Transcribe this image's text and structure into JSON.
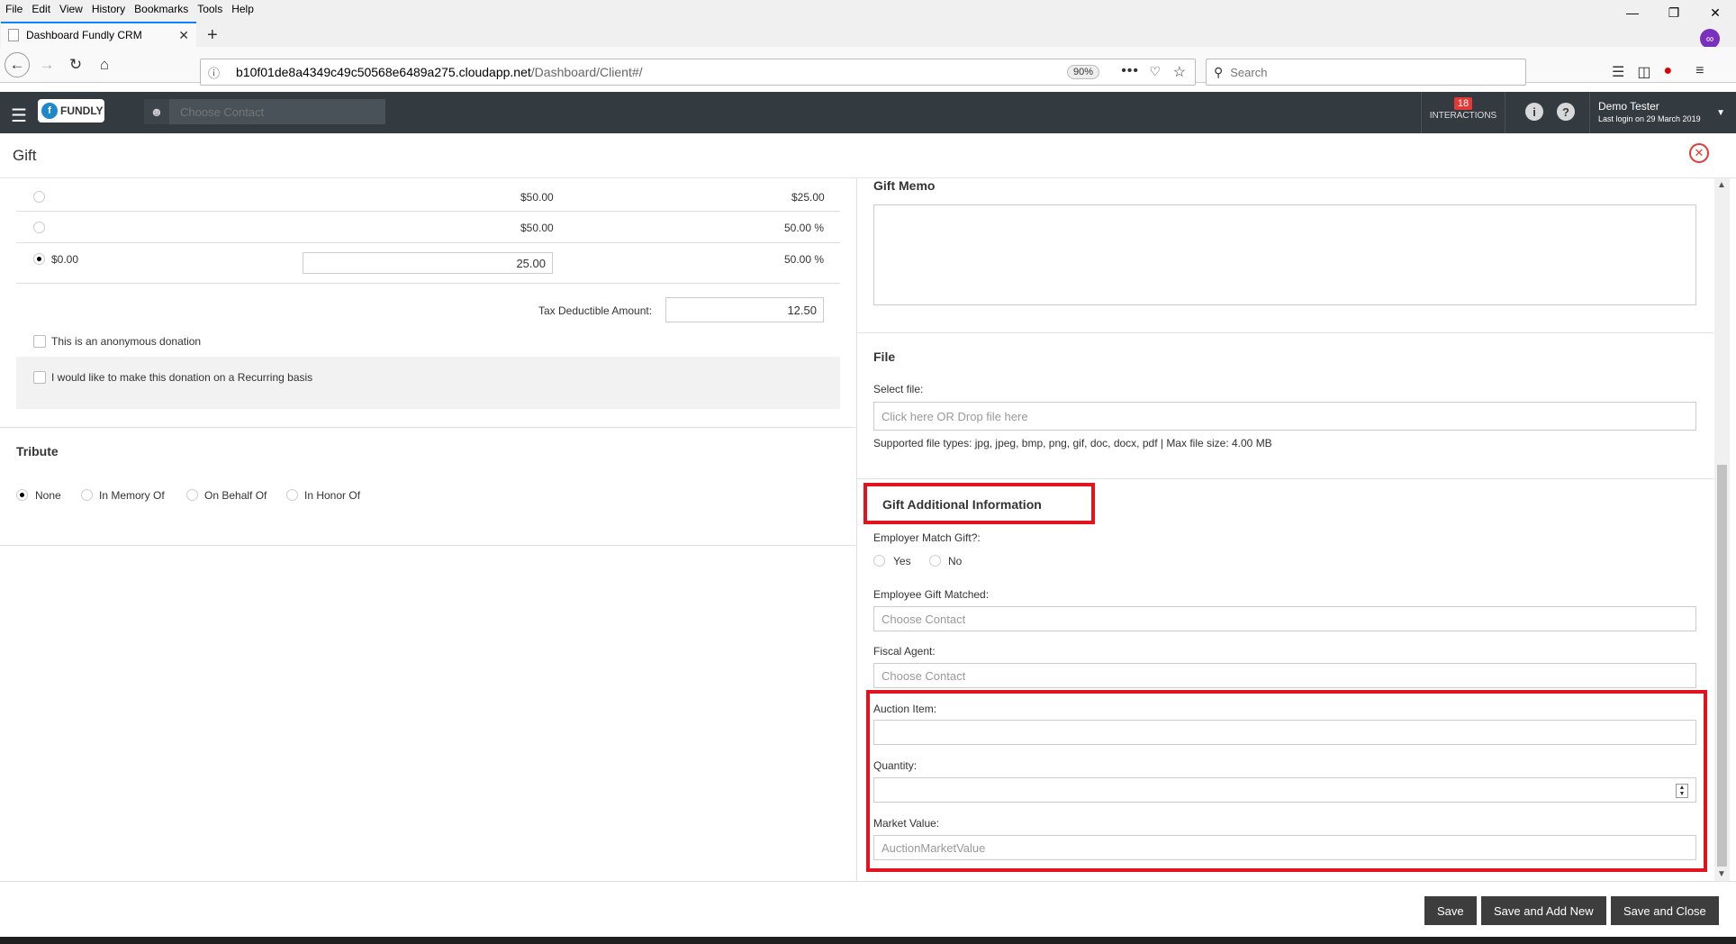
{
  "browser": {
    "menu": [
      "File",
      "Edit",
      "View",
      "History",
      "Bookmarks",
      "Tools",
      "Help"
    ],
    "tab_title": "Dashboard Fundly CRM",
    "url_host": "b10f01de8a4349c49c50568e6489a275.cloudapp.net",
    "url_path": "/Dashboard/Client#/",
    "zoom": "90%",
    "search_placeholder": "Search"
  },
  "app": {
    "logo_text": "FUNDLY",
    "contact_placeholder": "Choose Contact",
    "interactions_count": "18",
    "interactions_label": "INTERACTIONS",
    "user_name": "Demo Tester",
    "last_login": "Last login on 29 March 2019",
    "page_title": "Gift"
  },
  "amounts": {
    "rows": [
      {
        "left": "",
        "mid": "$50.00",
        "right": "$25.00",
        "selected": false
      },
      {
        "left": "",
        "mid": "$50.00",
        "right": "50.00 %",
        "selected": false
      },
      {
        "left": "$0.00",
        "mid": "25.00",
        "right": "50.00 %",
        "selected": true
      }
    ],
    "tax_label": "Tax Deductible Amount:",
    "tax_value": "12.50",
    "anonymous_label": "This is an anonymous donation",
    "recurring_label": "I would like to make this donation on a Recurring basis"
  },
  "tribute": {
    "title": "Tribute",
    "options": [
      "None",
      "In Memory Of",
      "On Behalf Of",
      "In Honor Of"
    ],
    "selected": "None"
  },
  "memo": {
    "title": "Gift Memo"
  },
  "file": {
    "title": "File",
    "select_label": "Select file:",
    "drop_placeholder": "Click here OR Drop file here",
    "supported": "Supported file types: jpg, jpeg, bmp, png, gif, doc, docx, pdf | Max file size: 4.00 MB"
  },
  "additional": {
    "title": "Gift Additional Information",
    "employer_match_label": "Employer Match Gift?:",
    "yes": "Yes",
    "no": "No",
    "employee_matched_label": "Employee Gift Matched:",
    "employee_matched_placeholder": "Choose Contact",
    "fiscal_agent_label": "Fiscal Agent:",
    "fiscal_agent_placeholder": "Choose Contact",
    "auction_item_label": "Auction Item:",
    "quantity_label": "Quantity:",
    "market_value_label": "Market Value:",
    "market_value_placeholder": "AuctionMarketValue"
  },
  "footer": {
    "save": "Save",
    "save_add_new": "Save and Add New",
    "save_close": "Save and Close"
  },
  "colors": {
    "header_bg": "#333a40",
    "highlight": "#e0131f",
    "badge": "#e53935",
    "button": "#3d3d3d"
  }
}
